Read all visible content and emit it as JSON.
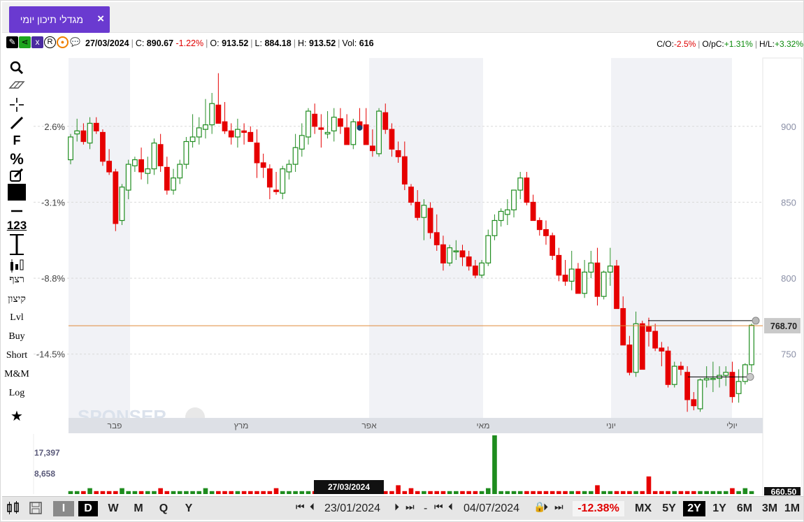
{
  "tab": {
    "title": "מגדלי תיכון יומי",
    "close": "×"
  },
  "quote": {
    "date": "27/03/2024",
    "c_label": "C:",
    "c_value": "890.67",
    "c_change": "-1.22%",
    "o_label": "O:",
    "o_value": "913.52",
    "l_label": "L:",
    "l_value": "884.18",
    "h_label": "H:",
    "h_value": "913.52",
    "vol_label": "Vol:",
    "vol_value": "616"
  },
  "stats": {
    "co_label": "C/O:",
    "co_value": "-2.5%",
    "opc_label": "O/pC:",
    "opc_value": "+1.31%",
    "hl_label": "H/L:",
    "hl_value": "+3.32%"
  },
  "left_tools": {
    "icons": [
      "search-icon",
      "eraser-icon",
      "crosshair-icon",
      "pencil-icon"
    ],
    "f": "F",
    "pct": "%",
    "num": "123",
    "t1": "רצף",
    "t2": "קיצון",
    "lvl": "Lvl",
    "buy": "Buy",
    "short": "Short",
    "mm": "M&M",
    "log": "Log"
  },
  "watermark": "SPONSER",
  "price_label": "768.70",
  "bottom": {
    "periods": [
      "I",
      "D",
      "W",
      "M",
      "Q",
      "Y"
    ],
    "from_date": "23/01/2024",
    "dash": "-",
    "to_date": "04/07/2024",
    "change": "-12.38%",
    "ranges": [
      "MX",
      "5Y",
      "2Y",
      "1Y",
      "6M",
      "3M",
      "1M"
    ],
    "selected_range": "2Y",
    "selected_period": "D"
  },
  "chart_data": {
    "type": "candlestick",
    "price_axis": {
      "ticks": [
        900,
        850,
        800,
        750
      ],
      "ylim": [
        708,
        945
      ]
    },
    "pct_axis": {
      "ticks": [
        "2.6%",
        "-3.1%",
        "-8.8%",
        "-14.5%"
      ]
    },
    "month_labels": [
      "פבר",
      "מרץ",
      "אפר",
      "מאי",
      "יוני",
      "יולי"
    ],
    "volume_axis": {
      "ticks": [
        "17,397",
        "8,658"
      ]
    },
    "volume_last_label": "660.50",
    "crosshair_date": "27/03/2024",
    "horizontal_line": 768.7,
    "candles": [
      [
        878,
        895,
        875,
        893
      ],
      [
        895,
        905,
        890,
        897
      ],
      [
        897,
        902,
        888,
        890
      ],
      [
        889,
        906,
        885,
        902
      ],
      [
        902,
        906,
        895,
        897
      ],
      [
        896,
        898,
        874,
        877
      ],
      [
        877,
        885,
        868,
        870
      ],
      [
        870,
        872,
        831,
        836
      ],
      [
        838,
        862,
        835,
        860
      ],
      [
        858,
        878,
        852,
        875
      ],
      [
        874,
        880,
        870,
        878
      ],
      [
        878,
        886,
        865,
        870
      ],
      [
        869,
        880,
        862,
        872
      ],
      [
        872,
        892,
        868,
        889
      ],
      [
        888,
        895,
        870,
        874
      ],
      [
        873,
        880,
        855,
        858
      ],
      [
        858,
        872,
        855,
        866
      ],
      [
        866,
        878,
        862,
        875
      ],
      [
        875,
        893,
        872,
        890
      ],
      [
        890,
        908,
        886,
        893
      ],
      [
        893,
        906,
        888,
        899
      ],
      [
        898,
        918,
        892,
        901
      ],
      [
        901,
        922,
        895,
        915
      ],
      [
        914,
        935,
        905,
        902
      ],
      [
        903,
        916,
        895,
        897
      ],
      [
        897,
        902,
        888,
        893
      ],
      [
        893,
        905,
        886,
        898
      ],
      [
        897,
        902,
        888,
        896
      ],
      [
        896,
        900,
        890,
        890
      ],
      [
        889,
        898,
        866,
        876
      ],
      [
        876,
        882,
        866,
        873
      ],
      [
        872,
        875,
        852,
        860
      ],
      [
        858,
        870,
        855,
        857
      ],
      [
        856,
        874,
        852,
        872
      ],
      [
        870,
        878,
        865,
        875
      ],
      [
        875,
        895,
        870,
        886
      ],
      [
        885,
        902,
        880,
        894
      ],
      [
        893,
        912,
        888,
        910
      ],
      [
        908,
        915,
        895,
        900
      ],
      [
        899,
        908,
        886,
        898
      ],
      [
        895,
        910,
        892,
        896
      ],
      [
        897,
        912,
        890,
        906
      ],
      [
        905,
        912,
        895,
        900
      ],
      [
        899,
        908,
        889,
        888
      ],
      [
        888,
        905,
        885,
        903
      ],
      [
        903,
        912,
        898,
        900
      ],
      [
        901,
        912,
        888,
        888
      ],
      [
        887,
        898,
        880,
        884
      ],
      [
        882,
        912,
        880,
        910
      ],
      [
        909,
        915,
        895,
        898
      ],
      [
        898,
        902,
        880,
        885
      ],
      [
        884,
        890,
        876,
        880
      ],
      [
        880,
        890,
        858,
        862
      ],
      [
        860,
        862,
        848,
        850
      ],
      [
        850,
        858,
        838,
        840
      ],
      [
        840,
        852,
        825,
        848
      ],
      [
        846,
        850,
        826,
        830
      ],
      [
        830,
        842,
        818,
        822
      ],
      [
        822,
        828,
        805,
        810
      ],
      [
        810,
        822,
        808,
        820
      ],
      [
        818,
        825,
        812,
        818
      ],
      [
        818,
        822,
        808,
        814
      ],
      [
        814,
        818,
        805,
        808
      ],
      [
        808,
        812,
        800,
        802
      ],
      [
        802,
        812,
        800,
        810
      ],
      [
        810,
        832,
        808,
        828
      ],
      [
        828,
        842,
        825,
        838
      ],
      [
        838,
        846,
        834,
        844
      ],
      [
        842,
        852,
        835,
        845
      ],
      [
        845,
        856,
        840,
        858
      ],
      [
        858,
        870,
        852,
        866
      ],
      [
        866,
        870,
        848,
        850
      ],
      [
        850,
        855,
        838,
        838
      ],
      [
        838,
        840,
        828,
        832
      ],
      [
        832,
        838,
        822,
        828
      ],
      [
        828,
        830,
        812,
        815
      ],
      [
        815,
        820,
        798,
        802
      ],
      [
        802,
        812,
        795,
        798
      ],
      [
        798,
        818,
        792,
        806
      ],
      [
        806,
        810,
        790,
        790
      ],
      [
        790,
        812,
        787,
        804
      ],
      [
        804,
        818,
        800,
        810
      ],
      [
        810,
        820,
        782,
        788
      ],
      [
        788,
        805,
        786,
        804
      ],
      [
        804,
        820,
        795,
        808
      ],
      [
        808,
        812,
        780,
        780
      ],
      [
        780,
        788,
        760,
        756
      ],
      [
        756,
        762,
        736,
        738
      ],
      [
        738,
        778,
        735,
        770
      ],
      [
        770,
        772,
        740,
        740
      ],
      [
        768,
        774,
        755,
        765
      ],
      [
        765,
        770,
        752,
        754
      ],
      [
        754,
        758,
        742,
        752
      ],
      [
        752,
        755,
        728,
        730
      ],
      [
        730,
        745,
        728,
        742
      ],
      [
        742,
        745,
        736,
        740
      ],
      [
        738,
        742,
        712,
        720
      ],
      [
        720,
        725,
        713,
        716
      ],
      [
        714,
        734,
        712,
        733
      ],
      [
        733,
        742,
        728,
        734
      ],
      [
        734,
        745,
        725,
        734
      ],
      [
        734,
        742,
        728,
        736
      ],
      [
        736,
        742,
        729,
        738
      ],
      [
        738,
        745,
        718,
        722
      ],
      [
        724,
        740,
        718,
        732
      ],
      [
        732,
        744,
        730,
        743
      ],
      [
        743,
        770,
        738,
        769
      ]
    ],
    "volumes": [
      1,
      1,
      1,
      2,
      1,
      1,
      1,
      1,
      2,
      1,
      1,
      1,
      1,
      1,
      2,
      1,
      1,
      1,
      1,
      1,
      1,
      2,
      1,
      1,
      1,
      1,
      1,
      1,
      1,
      1,
      1,
      1,
      2,
      1,
      1,
      1,
      1,
      1,
      1,
      2,
      1,
      1,
      1,
      1,
      1,
      1,
      1,
      1,
      1,
      1,
      1,
      3,
      1,
      2,
      1,
      1,
      1,
      1,
      1,
      1,
      1,
      1,
      1,
      1,
      1,
      2,
      20,
      1,
      1,
      1,
      1,
      1,
      1,
      1,
      1,
      1,
      1,
      1,
      1,
      1,
      1,
      1,
      3,
      1,
      1,
      1,
      1,
      1,
      1,
      1,
      6,
      1,
      1,
      1,
      1,
      1,
      1,
      1,
      1,
      1,
      1,
      1,
      1,
      2,
      1,
      2,
      1
    ]
  }
}
